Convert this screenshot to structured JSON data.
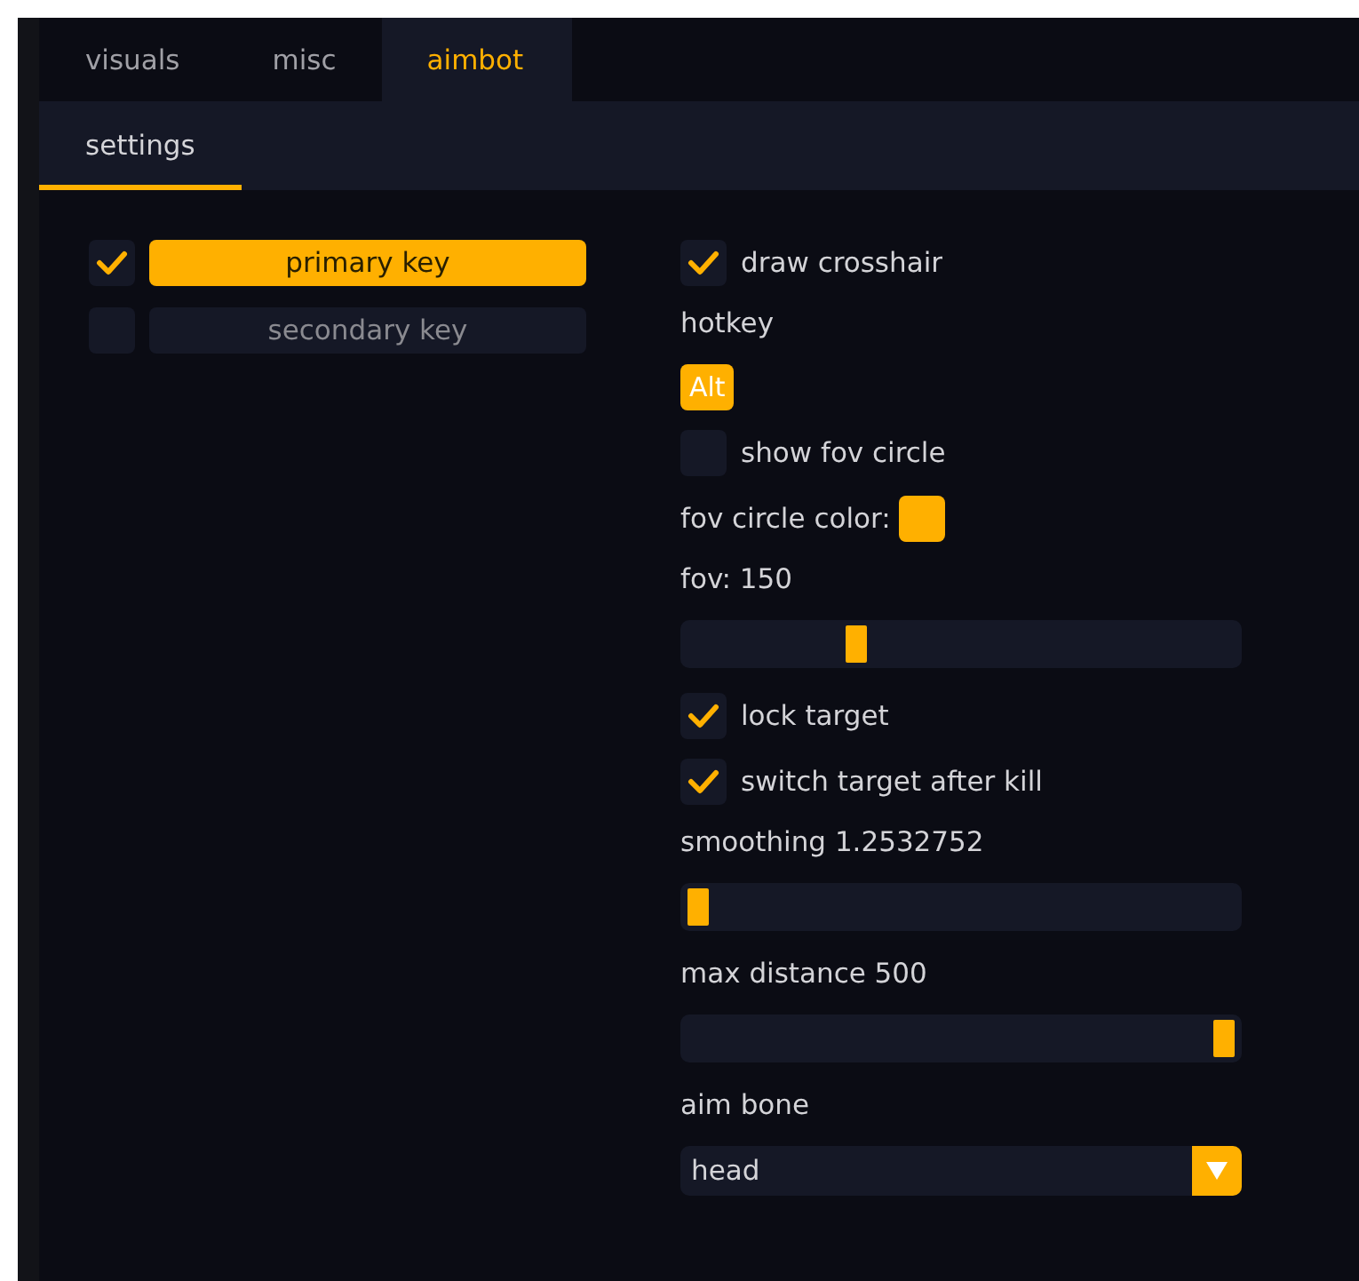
{
  "tabs": [
    {
      "label": "visuals",
      "selected": false
    },
    {
      "label": "misc",
      "selected": false
    },
    {
      "label": "aimbot",
      "selected": true
    }
  ],
  "subtabs": [
    {
      "label": "settings",
      "selected": true
    }
  ],
  "keys": [
    {
      "label": "primary key",
      "checked": true,
      "selected": true
    },
    {
      "label": "secondary key",
      "checked": false,
      "selected": false
    }
  ],
  "settings": [
    {
      "kind": "checkbox",
      "label": "draw crosshair",
      "checked": true
    },
    {
      "kind": "label",
      "label": "hotkey"
    },
    {
      "kind": "hotkey",
      "value": "Alt"
    },
    {
      "kind": "checkbox",
      "label": "show fov circle",
      "checked": false
    },
    {
      "kind": "color",
      "label": "fov circle color:",
      "color": "#ffb000"
    },
    {
      "kind": "label",
      "label": "fov: 150"
    },
    {
      "kind": "slider",
      "level": 0.3
    },
    {
      "kind": "checkbox",
      "label": "lock target",
      "checked": true
    },
    {
      "kind": "checkbox",
      "label": "switch target after kill",
      "checked": true
    },
    {
      "kind": "label",
      "label": "smoothing 1.2532752"
    },
    {
      "kind": "slider",
      "level": 0.0
    },
    {
      "kind": "label",
      "label": "max distance 500"
    },
    {
      "kind": "slider",
      "level": 1.0
    },
    {
      "kind": "label",
      "label": "aim bone"
    },
    {
      "kind": "dropdown",
      "value": "head"
    }
  ]
}
